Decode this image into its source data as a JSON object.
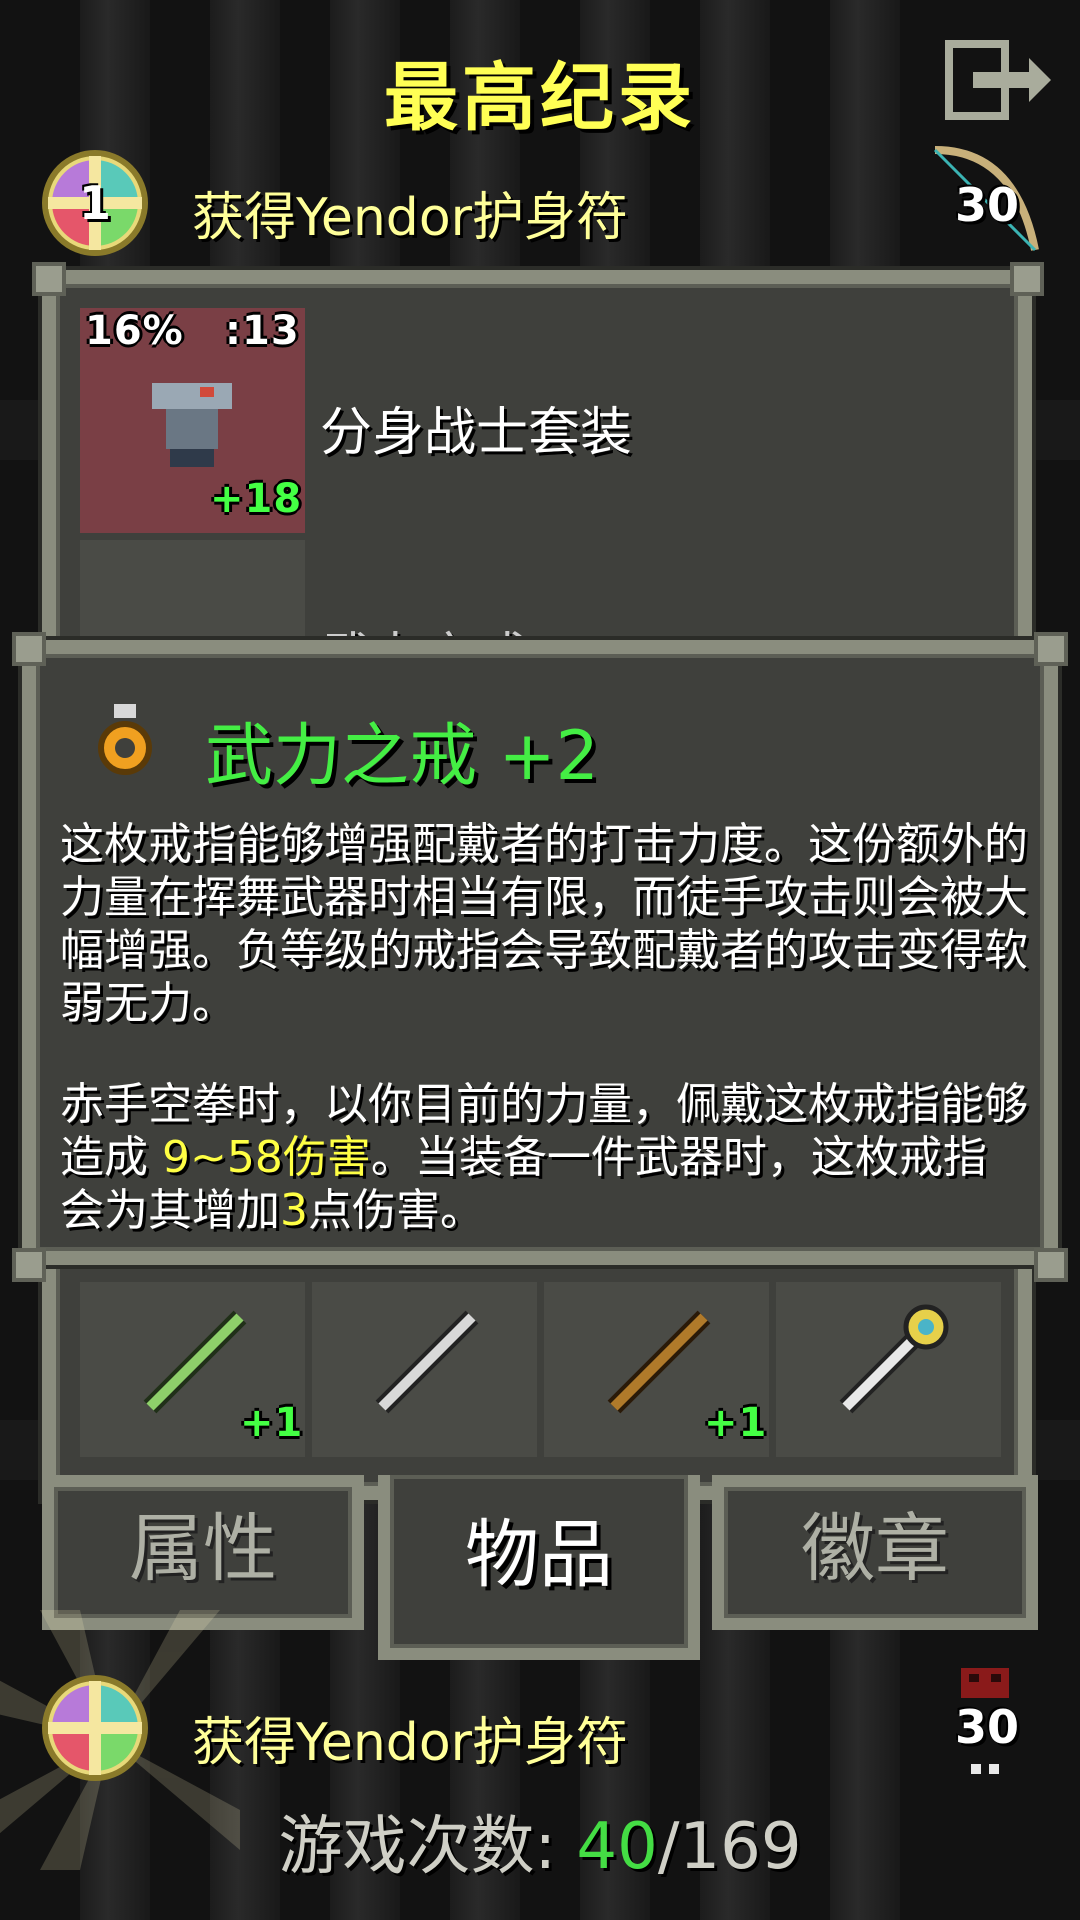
{
  "header": {
    "title": "最高纪录",
    "exit_icon": "exit-icon"
  },
  "records": [
    {
      "rank": "1",
      "text": "获得Yendor护身符",
      "level": "30",
      "level_icon": "bow-icon"
    },
    {
      "rank": "",
      "text": "获得Yendor护身符",
      "level": "30",
      "level_icon": "skull-icon"
    }
  ],
  "items": {
    "first": {
      "name": "分身战士套装",
      "durability": "16%",
      "tier": ":13",
      "upgrade": "+18",
      "icon": "armor-icon"
    },
    "second_partial_name": "武力之戒",
    "wands": [
      {
        "icon": "wand-green-icon",
        "upgrade": "+1"
      },
      {
        "icon": "wand-silver-icon",
        "upgrade": ""
      },
      {
        "icon": "wand-wood-icon",
        "upgrade": "+1"
      },
      {
        "icon": "staff-gold-icon",
        "upgrade": ""
      }
    ]
  },
  "tooltip": {
    "icon": "ring-icon",
    "title": "武力之戒 +2",
    "desc1": "这枚戒指能够增强配戴者的打击力度。这份额外的力量在挥舞武器时相当有限，而徒手攻击则会被大幅增强。负等级的戒指会导致配戴者的攻击变得软弱无力。",
    "desc2_a": "赤手空拳时，以你目前的力量，佩戴这枚戒指能够造成 ",
    "desc2_dmg": "9~58伤害",
    "desc2_b": "。当装备一件武器时，这枚戒指会为其增加",
    "desc2_num": "3",
    "desc2_c": "点伤害。"
  },
  "tabs": [
    {
      "label": "属性",
      "active": false
    },
    {
      "label": "物品",
      "active": true
    },
    {
      "label": "徽章",
      "active": false
    }
  ],
  "footer": {
    "label": "游戏次数: ",
    "current": "40",
    "separator": "/",
    "total": "169"
  },
  "colors": {
    "title": "#ffff55",
    "green": "#44ee44",
    "panel": "#3f403c",
    "border": "#8a8d7e"
  }
}
